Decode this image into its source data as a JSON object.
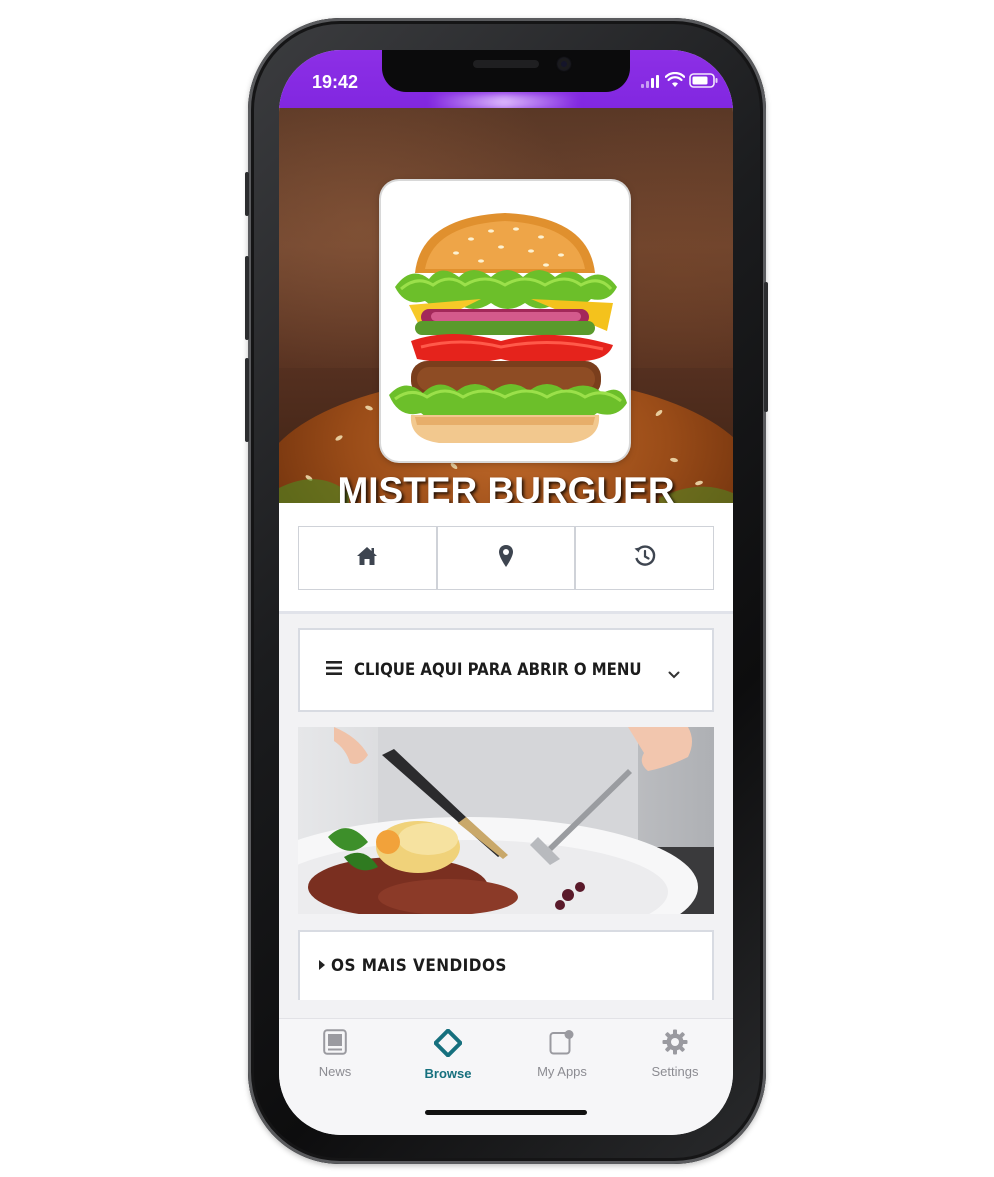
{
  "status_bar": {
    "time": "19:42",
    "color": "#8a2be2"
  },
  "hero": {
    "title": "MISTER BURGUER",
    "logo_image": "hamburger-photo",
    "background_image": "burger-bun-closeup"
  },
  "nav_icons": [
    {
      "icon": "home-icon"
    },
    {
      "icon": "map-pin-icon"
    },
    {
      "icon": "history-icon"
    }
  ],
  "menu": {
    "icon": "hamburger-menu-icon",
    "label": "CLIQUE AQUI PARA ABRIR O MENU",
    "chevron": "chevron-down-icon"
  },
  "banner": {
    "image": "plated-steak-dinner"
  },
  "sections": {
    "best_sellers_label": "OS MAIS VENDIDOS"
  },
  "tabbar": {
    "tabs": [
      {
        "label": "News",
        "icon": "news-icon",
        "active": false
      },
      {
        "label": "Browse",
        "icon": "browse-icon",
        "active": true
      },
      {
        "label": "My Apps",
        "icon": "my-apps-icon",
        "active": false
      },
      {
        "label": "Settings",
        "icon": "gear-icon",
        "active": false
      }
    ],
    "active_color": "#16707e"
  }
}
